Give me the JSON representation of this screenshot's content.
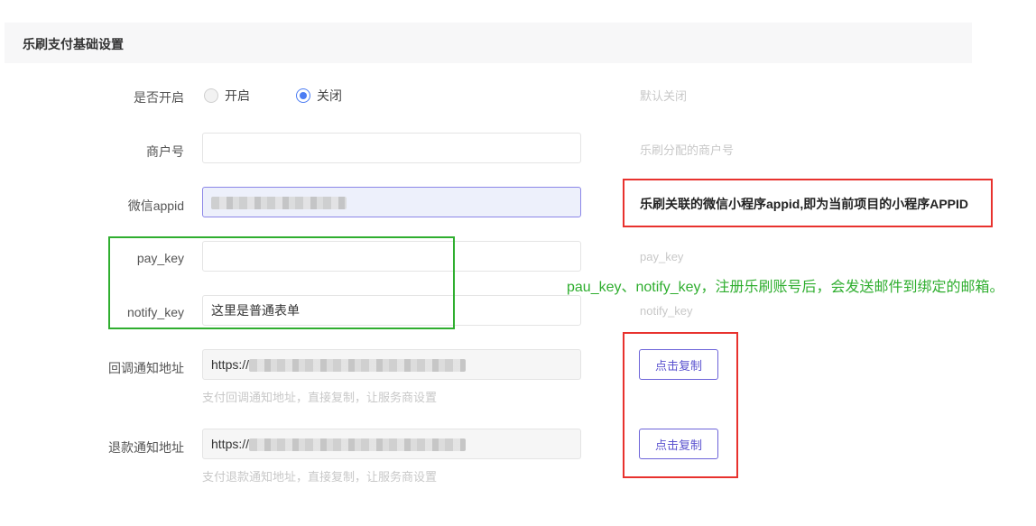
{
  "section": {
    "title": "乐刷支付基础设置"
  },
  "fields": {
    "enabled": {
      "label": "是否开启",
      "options": [
        "开启",
        "关闭"
      ],
      "selected": "关闭",
      "hint": "默认关闭"
    },
    "merchant_no": {
      "label": "商户号",
      "value": "",
      "hint": "乐刷分配的商户号"
    },
    "wechat_appid": {
      "label": "微信appid",
      "value": ""
    },
    "pay_key": {
      "label": "pay_key",
      "value": "",
      "hint": "pay_key"
    },
    "notify_key": {
      "label": "notify_key",
      "value": "这里是普通表单",
      "hint": "notify_key"
    },
    "callback_url": {
      "label": "回调通知地址",
      "value_prefix": "https://",
      "help": "支付回调通知地址，直接复制，让服务商设置",
      "button": "点击复制"
    },
    "refund_url": {
      "label": "退款通知地址",
      "value_prefix": "https://",
      "help": "支付退款通知地址，直接复制，让服务商设置",
      "button": "点击复制"
    }
  },
  "annotations": {
    "appid_note": "乐刷关联的微信小程序appid,即为当前项目的小程序APPID",
    "keys_note": "pau_key、notify_key，注册乐刷账号后，会发送邮件到绑定的邮箱。"
  },
  "colors": {
    "accent": "#4b7cf3",
    "button": "#6c63d9",
    "red_box": "#e8322e",
    "green_box": "#2fae2f"
  }
}
